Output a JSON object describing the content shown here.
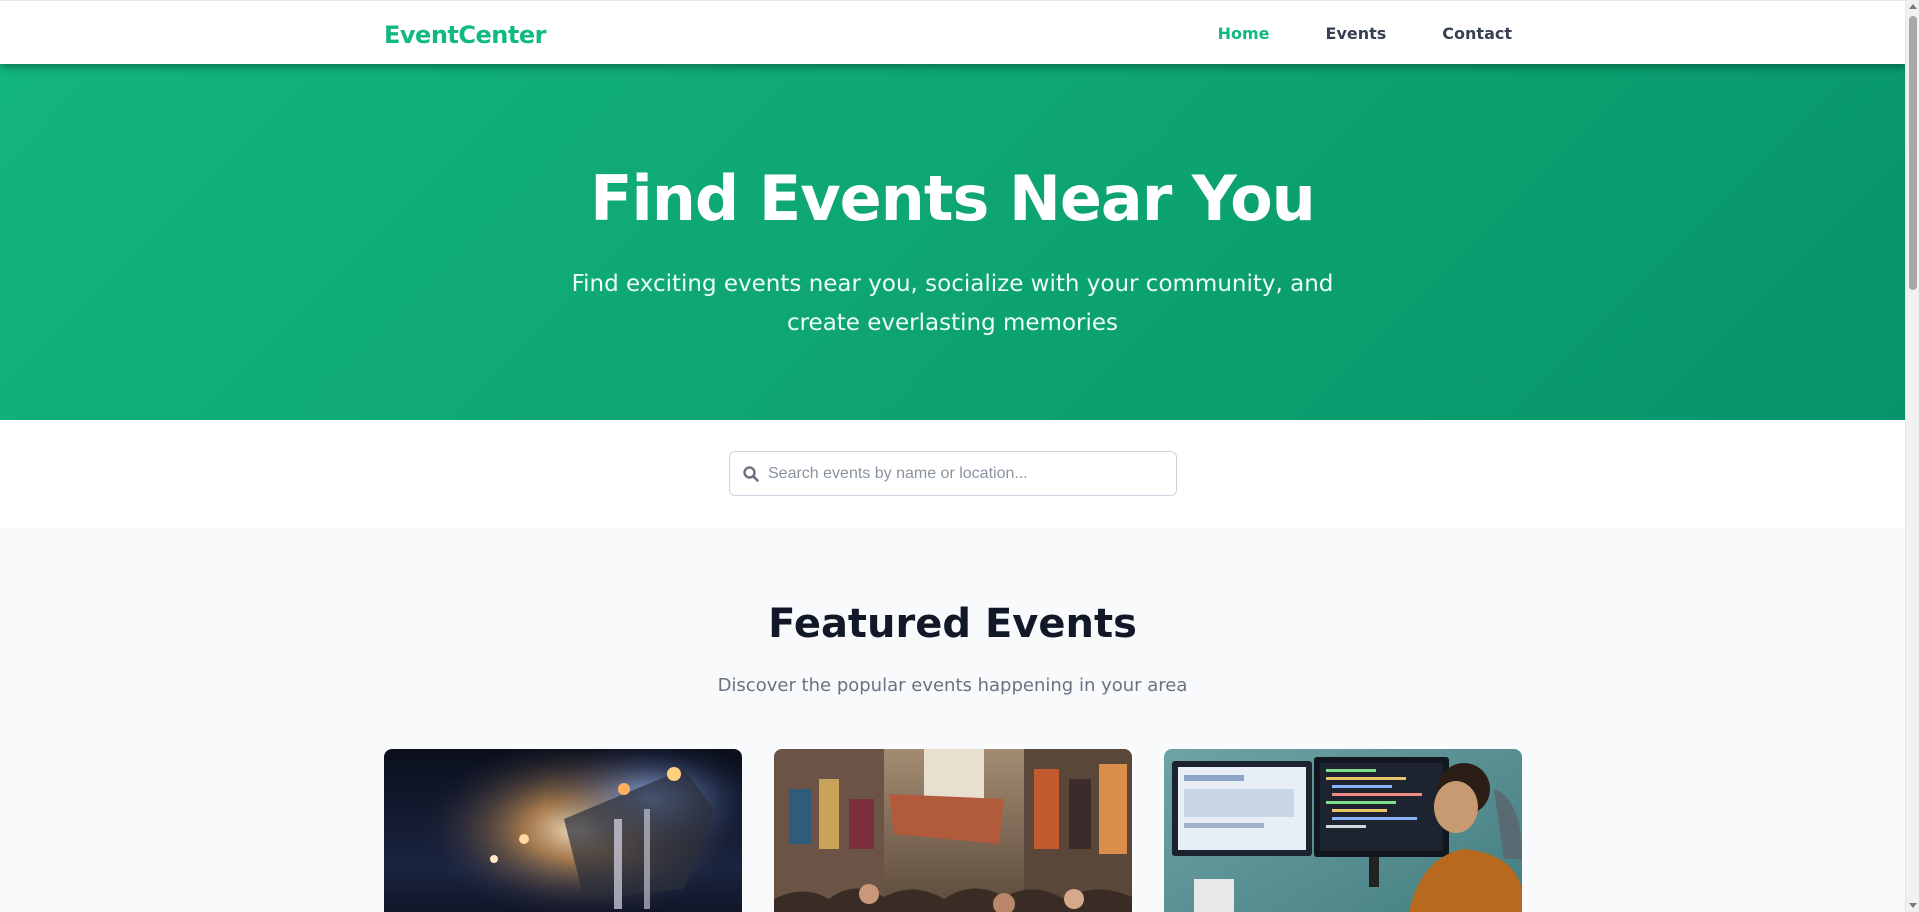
{
  "header": {
    "brand": "EventCenter",
    "nav": [
      {
        "label": "Home",
        "active": true
      },
      {
        "label": "Events",
        "active": false
      },
      {
        "label": "Contact",
        "active": false
      }
    ]
  },
  "hero": {
    "title": "Find Events Near You",
    "subtitle": "Find exciting events near you, socialize with your community, and create everlasting memories"
  },
  "search": {
    "placeholder": "Search events by name or location...",
    "value": "",
    "icon": "search-icon"
  },
  "featured": {
    "title": "Featured Events",
    "subtitle": "Discover the popular events happening in your area",
    "cards": [
      {
        "image": "concert-stage-photo"
      },
      {
        "image": "street-market-photo"
      },
      {
        "image": "developer-coding-photo"
      }
    ]
  },
  "colors": {
    "brand": "#10b981",
    "hero_start": "#12b47f",
    "hero_end": "#06936a",
    "heading": "#111827",
    "muted": "#6b7280"
  }
}
